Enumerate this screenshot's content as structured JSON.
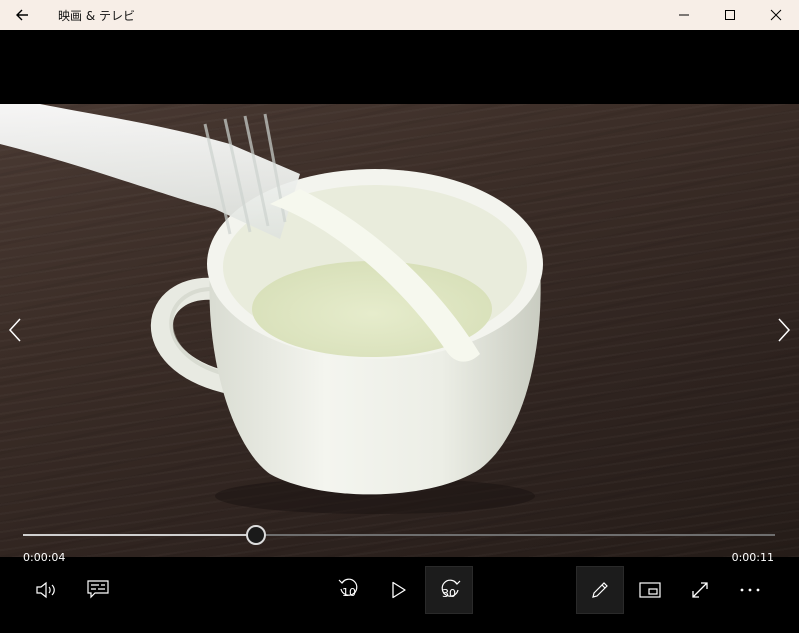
{
  "window": {
    "title": "映画 & テレビ"
  },
  "icons": {
    "back": "back-arrow-icon",
    "minimize": "minimize-icon",
    "maximize": "maximize-icon",
    "close": "close-icon",
    "prev": "chevron-left-icon",
    "next": "chevron-right-icon",
    "volume": "volume-icon",
    "subtitles": "subtitles-icon",
    "rewind": "rewind-10-icon",
    "play": "play-icon",
    "forward": "forward-30-icon",
    "edit": "pencil-icon",
    "mini_view": "mini-view-icon",
    "fullscreen": "fullscreen-icon",
    "more": "more-icon"
  },
  "player": {
    "elapsed": "0:00:04",
    "total": "0:00:11",
    "progress": 0.31,
    "rewind_seconds": "10",
    "forward_seconds": "30"
  },
  "colors": {
    "titlebar_bg": "#f7eee7",
    "background": "#000000",
    "seek_fill": "#cfcfcf",
    "seek_track": "#6e6e6e"
  }
}
